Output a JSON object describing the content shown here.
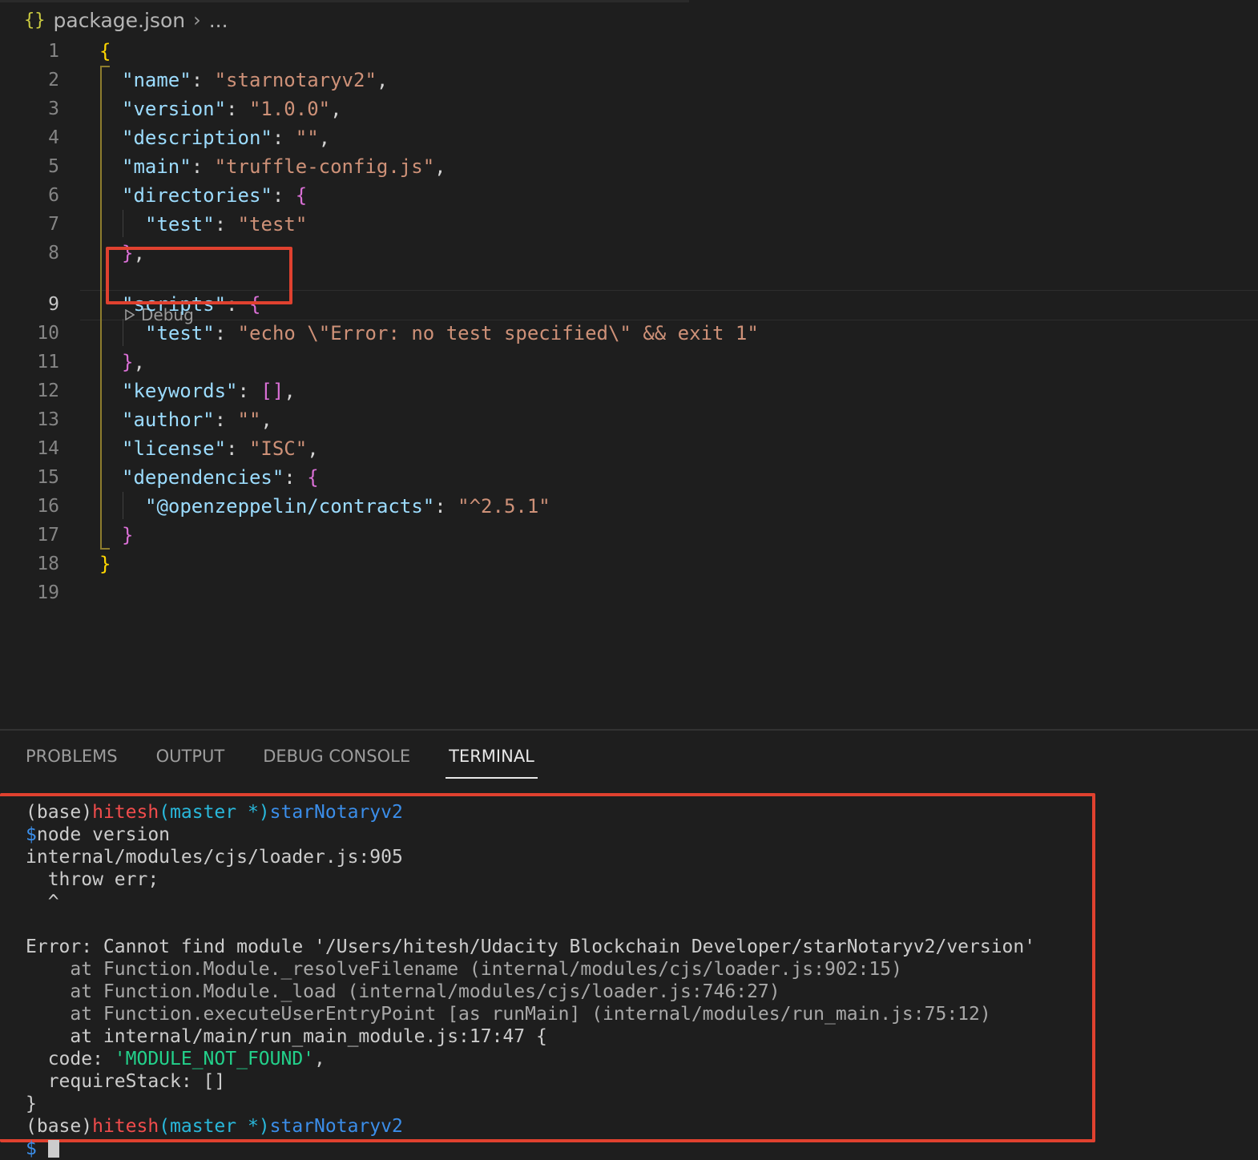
{
  "breadcrumb": {
    "file_icon": "{}",
    "file_name": "package.json",
    "separator": "›",
    "ellipsis": "..."
  },
  "editor": {
    "line_numbers": [
      "1",
      "2",
      "3",
      "4",
      "5",
      "6",
      "7",
      "8",
      "9",
      "10",
      "11",
      "12",
      "13",
      "14",
      "15",
      "16",
      "17",
      "18",
      "19"
    ],
    "active_line": "9",
    "tokens": {
      "l1_open": "{",
      "l2_key": "\"name\"",
      "l2_colon": ": ",
      "l2_val": "\"starnotaryv2\"",
      "l2_comma": ",",
      "l3_key": "\"version\"",
      "l3_colon": ": ",
      "l3_val": "\"1.0.0\"",
      "l3_comma": ",",
      "l4_key": "\"description\"",
      "l4_colon": ": ",
      "l4_val": "\"\"",
      "l4_comma": ",",
      "l5_key": "\"main\"",
      "l5_colon": ": ",
      "l5_val": "\"truffle-config.js\"",
      "l5_comma": ",",
      "l6_key": "\"directories\"",
      "l6_colon": ": ",
      "l6_brace": "{",
      "l7_key": "\"test\"",
      "l7_colon": ": ",
      "l7_val": "\"test\"",
      "l8_brace": "}",
      "l8_comma": ",",
      "l9_key": "\"scripts\"",
      "l9_colon": ": ",
      "l9_brace": "{",
      "l10_key": "\"test\"",
      "l10_colon": ": ",
      "l10_val": "\"echo \\\"Error: no test specified\\\" && exit 1\"",
      "l11_brace": "}",
      "l11_comma": ",",
      "l12_key": "\"keywords\"",
      "l12_colon": ": ",
      "l12_val": "[]",
      "l12_comma": ",",
      "l13_key": "\"author\"",
      "l13_colon": ": ",
      "l13_val": "\"\"",
      "l13_comma": ",",
      "l14_key": "\"license\"",
      "l14_colon": ": ",
      "l14_val": "\"ISC\"",
      "l14_comma": ",",
      "l15_key": "\"dependencies\"",
      "l15_colon": ": ",
      "l15_brace": "{",
      "l16_key": "\"@openzeppelin/contracts\"",
      "l16_colon": ": ",
      "l16_val": "\"^2.5.1\"",
      "l17_brace": "}",
      "l18_close": "}"
    },
    "codelens": {
      "icon": "play-icon",
      "label": "Debug"
    }
  },
  "panel": {
    "tabs": [
      {
        "label": "PROBLEMS"
      },
      {
        "label": "OUTPUT"
      },
      {
        "label": "DEBUG CONSOLE"
      },
      {
        "label": "TERMINAL"
      }
    ],
    "active_tab": "TERMINAL"
  },
  "terminal": {
    "prompt1": {
      "env": "(base)",
      "user": "hitesh",
      "branch": "(master *)",
      "dir": "starNotaryv2"
    },
    "cmd": {
      "sign": "$",
      "text": "node version"
    },
    "out": [
      "internal/modules/cjs/loader.js:905",
      "  throw err;",
      "  ^",
      "",
      "Error: Cannot find module '/Users/hitesh/Udacity Blockchain Developer/starNotaryv2/version'",
      "    at Function.Module._resolveFilename (internal/modules/cjs/loader.js:902:15)",
      "    at Function.Module._load (internal/modules/cjs/loader.js:746:27)",
      "    at Function.executeUserEntryPoint [as runMain] (internal/modules/run_main.js:75:12)",
      "    at internal/main/run_main_module.js:17:47 {"
    ],
    "code_label": "  code: ",
    "code_value": "'MODULE_NOT_FOUND'",
    "code_comma": ",",
    "require_stack": "  requireStack: []",
    "close": "}",
    "prompt2": {
      "env": "(base)",
      "user": "hitesh",
      "branch": "(master *)",
      "dir": "starNotaryv2"
    },
    "prompt2_sign": "$"
  },
  "colors": {
    "background": "#1e1e1e",
    "highlight_box": "#e0412f",
    "json_key": "#9cdcfe",
    "json_string": "#ce9178",
    "bracket_gold": "#ffd700",
    "bracket_magenta": "#da70d6"
  }
}
